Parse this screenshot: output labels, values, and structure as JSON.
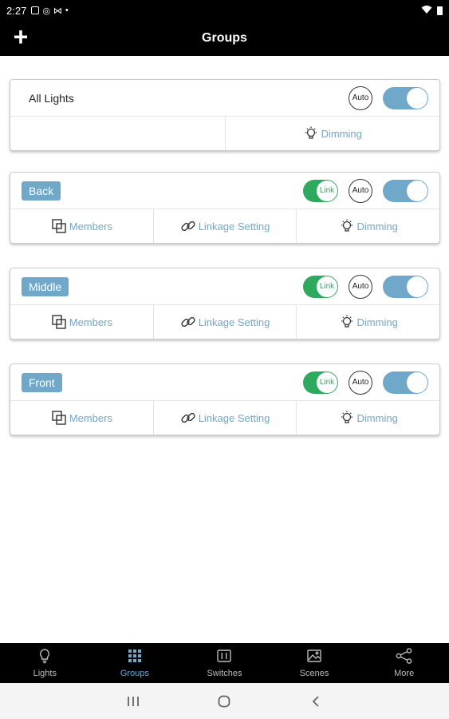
{
  "status_bar": {
    "time": "2:27"
  },
  "header": {
    "title": "Groups",
    "add_label": "+"
  },
  "all_lights": {
    "name": "All Lights",
    "auto_label": "Auto",
    "dimming_label": "Dimming"
  },
  "groups": [
    {
      "name": "Back",
      "link_label": "Link",
      "auto_label": "Auto",
      "members_label": "Members",
      "linkage_label": "Linkage Setting",
      "dimming_label": "Dimming"
    },
    {
      "name": "Middle",
      "link_label": "Link",
      "auto_label": "Auto",
      "members_label": "Members",
      "linkage_label": "Linkage Setting",
      "dimming_label": "Dimming"
    },
    {
      "name": "Front",
      "link_label": "Link",
      "auto_label": "Auto",
      "members_label": "Members",
      "linkage_label": "Linkage Setting",
      "dimming_label": "Dimming"
    }
  ],
  "tabs": [
    {
      "label": "Lights",
      "icon": "bulb-icon"
    },
    {
      "label": "Groups",
      "icon": "grid-icon",
      "active": true
    },
    {
      "label": "Switches",
      "icon": "switch-panel-icon"
    },
    {
      "label": "Scenes",
      "icon": "scene-image-icon"
    },
    {
      "label": "More",
      "icon": "share-icon"
    }
  ],
  "colors": {
    "accent": "#6fa8c9",
    "link_green": "#2eaa5f",
    "header_bg": "#000000"
  }
}
